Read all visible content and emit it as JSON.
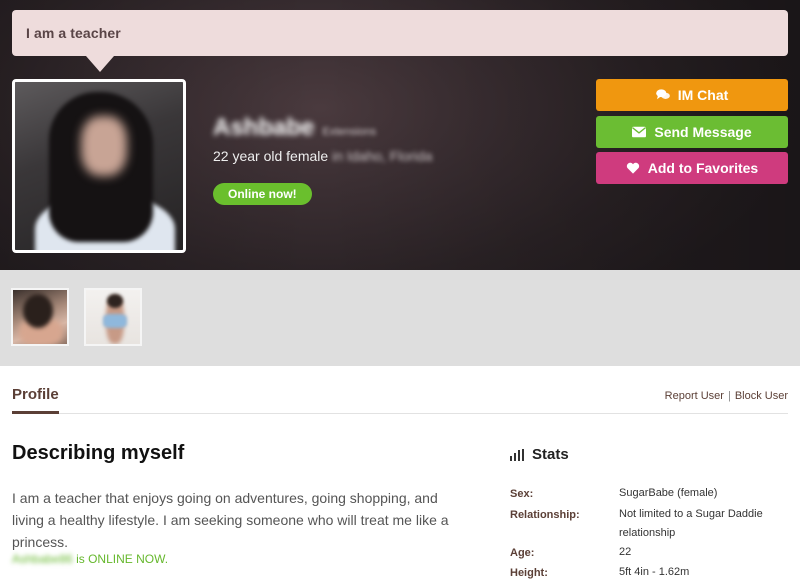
{
  "header": {
    "headline": "I am a teacher"
  },
  "profile": {
    "name": "Ashbabe",
    "name_suffix": "Extensions",
    "age_line": "22 year old female",
    "location": "in Idaho, Florida",
    "online_badge": "Online now!"
  },
  "actions": {
    "chat": "IM Chat",
    "message": "Send Message",
    "favorite": "Add to Favorites"
  },
  "tabs": {
    "profile": "Profile"
  },
  "moderation": {
    "report": "Report User",
    "separator": "|",
    "block": "Block User"
  },
  "about": {
    "title": "Describing myself",
    "text": "I am a teacher that enjoys going on adventures, going shopping, and living a healthy lifestyle. I am seeking someone who will treat me like a princess.",
    "online_user": "Ashbabe86",
    "online_text": " is ONLINE NOW."
  },
  "stats": {
    "title": "Stats",
    "rows": [
      {
        "label": "Sex:",
        "value": "SugarBabe (female)"
      },
      {
        "label": "Relationship:",
        "value": "Not limited to a Sugar Daddie relationship"
      },
      {
        "label": "Age:",
        "value": "22"
      },
      {
        "label": "Height:",
        "value": "5ft 4in - 1.62m"
      }
    ]
  },
  "colors": {
    "chat": "#f0970f",
    "message": "#6bbd33",
    "favorite": "#cf3b7e",
    "online": "#6abf2d",
    "accent": "#5b3f36"
  },
  "icons": {
    "chat": "chat-bubbles-icon",
    "message": "envelope-icon",
    "favorite": "heart-icon",
    "stats": "bar-chart-icon"
  }
}
